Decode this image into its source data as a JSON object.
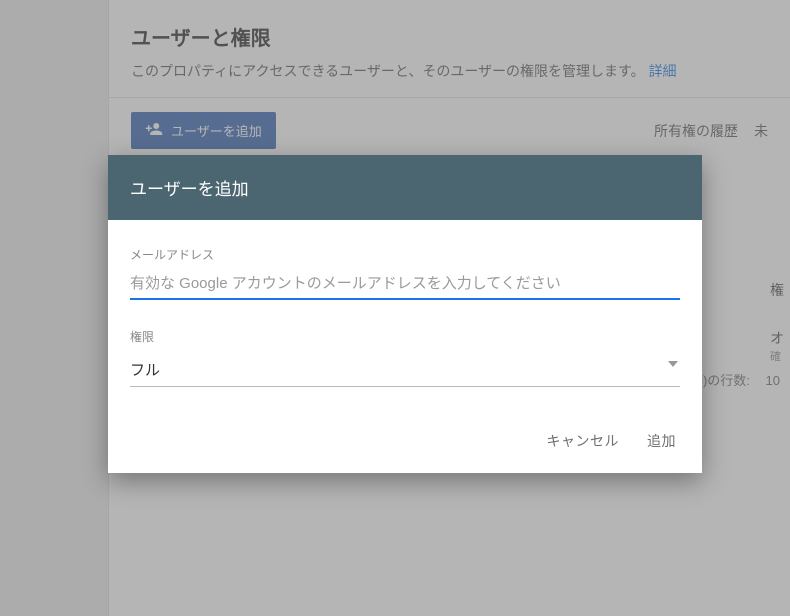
{
  "header": {
    "title": "ユーザーと権限",
    "subtitle_prefix": "このプロパティにアクセスできるユーザーと、そのユーザーの権限を管理します。",
    "details_link": "詳細"
  },
  "toolbar": {
    "add_user_label": "ユーザーを追加",
    "history_link": "所有権の履歴",
    "truncated_link": "未"
  },
  "table": {
    "col_permission_fragment": "権",
    "row1_fragment1": "オ",
    "row1_fragment2": "確",
    "rows_label_fragment": ")の行数:",
    "rows_value": "10"
  },
  "modal": {
    "title": "ユーザーを追加",
    "email_label": "メールアドレス",
    "email_placeholder": "有効な Google アカウントのメールアドレスを入力してください",
    "email_value": "",
    "permission_label": "権限",
    "permission_value": "フル",
    "cancel_label": "キャンセル",
    "add_label": "追加"
  }
}
